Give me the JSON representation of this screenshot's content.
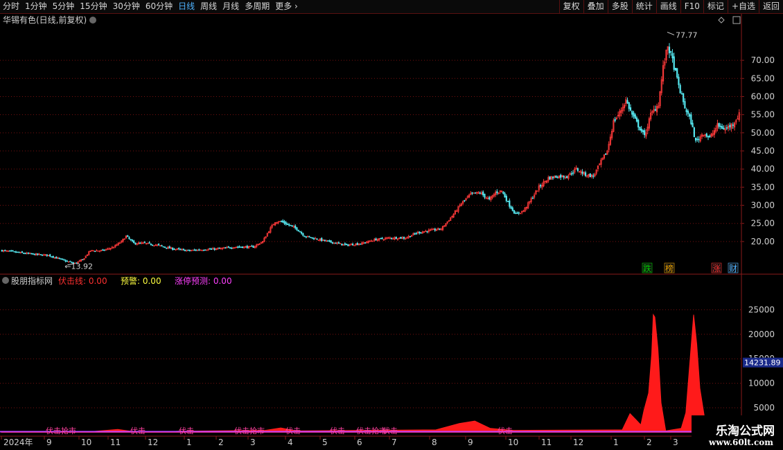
{
  "toolbar": {
    "periods": [
      "分时",
      "1分钟",
      "5分钟",
      "15分钟",
      "30分钟",
      "60分钟",
      "日线",
      "周线",
      "月线",
      "多周期",
      "更多"
    ],
    "active_period": "日线",
    "right_buttons": [
      "复权",
      "叠加",
      "多股",
      "统计",
      "画线",
      "F10",
      "标记",
      "+自选",
      "返回"
    ]
  },
  "main_panel": {
    "title": "华锡有色(日线,前复权)",
    "high_label": "77.77",
    "low_label": "13.92",
    "event_markers": [
      {
        "text": "跌",
        "color": "#00d000"
      },
      {
        "text": "榜",
        "color": "#e8a000"
      },
      {
        "text": "涨",
        "color": "#ff3030"
      },
      {
        "text": "财",
        "color": "#4fb3ff"
      }
    ]
  },
  "sub_panel": {
    "name": "股朋指标网",
    "items": [
      {
        "label": "伏击线:",
        "value": "0.00",
        "color": "#ff3030"
      },
      {
        "label": "预警:",
        "value": "0.00",
        "color": "#ffff40"
      },
      {
        "label": "涨停预测:",
        "value": "0.00",
        "color": "#ff40ff"
      }
    ],
    "current_value": "14231.89",
    "signal_text": "伏击",
    "signal_text_alt": "伏击抢市"
  },
  "x_axis": {
    "labels": [
      "2024年",
      "9",
      "10",
      "11",
      "12",
      "1",
      "2",
      "3",
      "4",
      "5",
      "6",
      "7",
      "8",
      "9",
      "10",
      "11",
      "12",
      "1",
      "2",
      "3"
    ]
  },
  "watermark": {
    "title": "乐淘公式网",
    "url": "www.60lt.com"
  },
  "chart_data": [
    {
      "type": "candlestick",
      "title": "华锡有色(日线,前复权)",
      "y_ticks": [
        20,
        25,
        30,
        35,
        40,
        45,
        50,
        55,
        60,
        65,
        70
      ],
      "ylim": [
        11,
        79
      ],
      "high": 77.77,
      "low": 13.92,
      "close_path": [
        [
          0,
          17.5
        ],
        [
          10,
          17.0
        ],
        [
          20,
          16.5
        ],
        [
          30,
          16.2
        ],
        [
          35,
          15.5
        ],
        [
          42,
          14.5
        ],
        [
          47,
          14.0
        ],
        [
          52,
          15.0
        ],
        [
          57,
          17.5
        ],
        [
          65,
          17.5
        ],
        [
          72,
          18.5
        ],
        [
          77,
          20.0
        ],
        [
          80,
          21.5
        ],
        [
          85,
          19.5
        ],
        [
          92,
          19.5
        ],
        [
          100,
          19.0
        ],
        [
          110,
          18.0
        ],
        [
          120,
          17.5
        ],
        [
          130,
          17.8
        ],
        [
          140,
          18.0
        ],
        [
          150,
          18.5
        ],
        [
          162,
          18.5
        ],
        [
          168,
          20.0
        ],
        [
          172,
          23.0
        ],
        [
          176,
          25.5
        ],
        [
          180,
          25.5
        ],
        [
          185,
          24.5
        ],
        [
          190,
          23.5
        ],
        [
          195,
          21.5
        ],
        [
          200,
          21.0
        ],
        [
          210,
          20.0
        ],
        [
          222,
          19.0
        ],
        [
          232,
          19.5
        ],
        [
          240,
          20.5
        ],
        [
          250,
          21.0
        ],
        [
          260,
          21.0
        ],
        [
          268,
          22.5
        ],
        [
          275,
          23.0
        ],
        [
          283,
          23.5
        ],
        [
          290,
          27.0
        ],
        [
          296,
          30.5
        ],
        [
          302,
          33.0
        ],
        [
          308,
          33.5
        ],
        [
          314,
          31.5
        ],
        [
          318,
          33.5
        ],
        [
          322,
          34.0
        ],
        [
          327,
          30.0
        ],
        [
          331,
          27.5
        ],
        [
          336,
          28.5
        ],
        [
          340,
          31.0
        ],
        [
          346,
          35.0
        ],
        [
          352,
          37.5
        ],
        [
          358,
          38.0
        ],
        [
          364,
          38.0
        ],
        [
          370,
          40.0
        ],
        [
          376,
          38.5
        ],
        [
          381,
          38.0
        ],
        [
          386,
          42.0
        ],
        [
          390,
          45.0
        ],
        [
          394,
          53.0
        ],
        [
          398,
          55.5
        ],
        [
          402,
          59.0
        ],
        [
          406,
          55.0
        ],
        [
          410,
          52.0
        ],
        [
          414,
          49.0
        ],
        [
          418,
          55.0
        ],
        [
          423,
          58.0
        ],
        [
          426,
          68.0
        ],
        [
          429,
          74.0
        ],
        [
          432,
          70.0
        ],
        [
          436,
          63.0
        ],
        [
          440,
          57.0
        ],
        [
          444,
          53.0
        ],
        [
          447,
          47.5
        ],
        [
          452,
          50.0
        ],
        [
          456,
          48.5
        ],
        [
          461,
          52.0
        ],
        [
          466,
          51.0
        ],
        [
          471,
          52.5
        ],
        [
          475,
          55.0
        ]
      ]
    },
    {
      "type": "area",
      "series": [
        {
          "name": "伏击线",
          "color": "#ff2020"
        }
      ],
      "y_ticks": [
        5000,
        10000,
        15000,
        20000,
        25000
      ],
      "ylim": [
        -500,
        30000
      ],
      "current_value": 14231.89,
      "points": [
        [
          0,
          100
        ],
        [
          60,
          200
        ],
        [
          75,
          600
        ],
        [
          85,
          150
        ],
        [
          170,
          400
        ],
        [
          180,
          900
        ],
        [
          190,
          300
        ],
        [
          280,
          500
        ],
        [
          295,
          1800
        ],
        [
          305,
          2300
        ],
        [
          315,
          800
        ],
        [
          330,
          400
        ],
        [
          400,
          500
        ],
        [
          405,
          3800
        ],
        [
          409,
          2500
        ],
        [
          412,
          1500
        ],
        [
          414,
          4500
        ],
        [
          417,
          8000
        ],
        [
          419,
          16000
        ],
        [
          420,
          24000
        ],
        [
          421,
          23500
        ],
        [
          423,
          17000
        ],
        [
          425,
          6000
        ],
        [
          428,
          300
        ],
        [
          438,
          800
        ],
        [
          441,
          4000
        ],
        [
          443,
          12000
        ],
        [
          445,
          20000
        ],
        [
          446,
          24000
        ],
        [
          448,
          18000
        ],
        [
          450,
          9000
        ],
        [
          452,
          5000
        ],
        [
          453,
          3000
        ]
      ]
    }
  ]
}
